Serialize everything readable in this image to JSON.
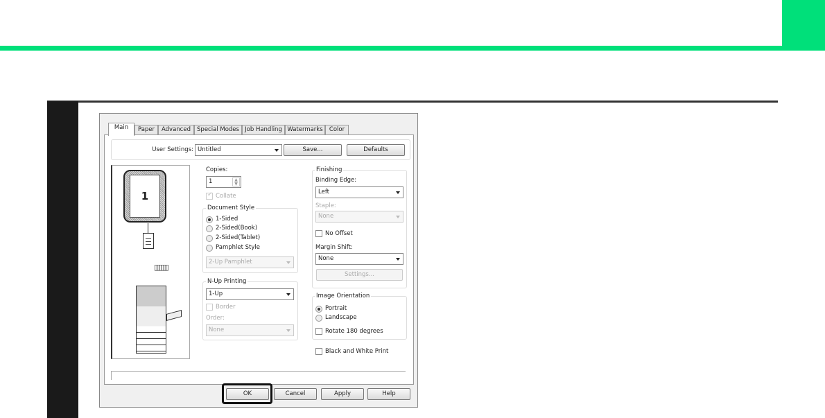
{
  "colors": {
    "accent": "#00e07a"
  },
  "tabs": [
    "Main",
    "Paper",
    "Advanced",
    "Special Modes",
    "Job Handling",
    "Watermarks",
    "Color"
  ],
  "user_settings": {
    "label": "User Settings:",
    "value": "Untitled",
    "save": "Save...",
    "defaults": "Defaults"
  },
  "preview": {
    "page_number": "1"
  },
  "copies": {
    "label": "Copies:",
    "value": "1",
    "collate": "Collate"
  },
  "document_style": {
    "title": "Document Style",
    "options": [
      "1-Sided",
      "2-Sided(Book)",
      "2-Sided(Tablet)",
      "Pamphlet Style"
    ],
    "selected": "1-Sided",
    "pamphlet": "2-Up Pamphlet"
  },
  "nup": {
    "title": "N-Up Printing",
    "value": "1-Up",
    "border": "Border",
    "order_label": "Order:",
    "order_value": "None"
  },
  "finishing": {
    "title": "Finishing",
    "binding_label": "Binding Edge:",
    "binding_value": "Left",
    "staple_label": "Staple:",
    "staple_value": "None",
    "no_offset": "No Offset",
    "margin_label": "Margin Shift:",
    "margin_value": "None",
    "settings": "Settings..."
  },
  "orientation": {
    "title": "Image Orientation",
    "portrait": "Portrait",
    "landscape": "Landscape",
    "rotate": "Rotate 180 degrees"
  },
  "bw_print": "Black and White Print",
  "buttons": {
    "ok": "OK",
    "cancel": "Cancel",
    "apply": "Apply",
    "help": "Help"
  }
}
